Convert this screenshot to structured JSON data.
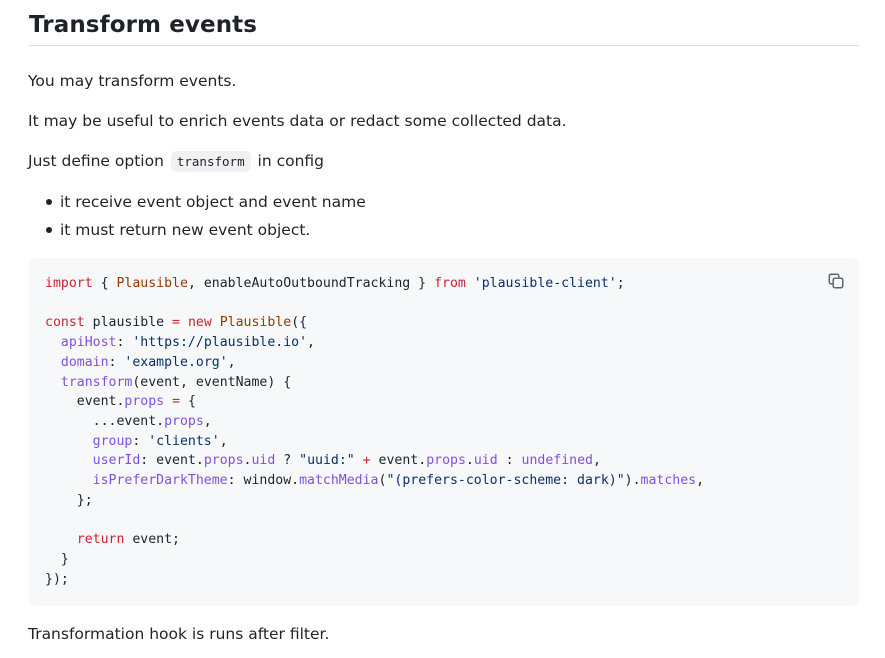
{
  "heading": "Transform events",
  "paragraphs": {
    "p1": "You may transform events.",
    "p2": "It may be useful to enrich events data or redact some collected data.",
    "p3_before": "Just define option",
    "p3_code": "transform",
    "p3_after": "in config"
  },
  "bullets": [
    "it receive event object and event name",
    "it must return new event object."
  ],
  "code": {
    "line1": {
      "import": "import",
      "open": " { ",
      "cls": "Plausible",
      "rest": ", enableAutoOutboundTracking } ",
      "from": "from",
      "sp": " ",
      "str": "'plausible-client'",
      "end": ";"
    },
    "line3": {
      "const": "const",
      "name": " plausible ",
      "eq": "=",
      "sp": " ",
      "new": "new",
      "sp2": " ",
      "cls": "Plausible",
      "end": "({"
    },
    "line4": {
      "indent": "  ",
      "prop": "apiHost",
      "colon": ": ",
      "str": "'https://plausible.io'",
      "end": ","
    },
    "line5": {
      "indent": "  ",
      "prop": "domain",
      "colon": ": ",
      "str": "'example.org'",
      "end": ","
    },
    "line6": {
      "indent": "  ",
      "prop": "transform",
      "rest": "(event, eventName) {"
    },
    "line7": {
      "indent": "    event.",
      "prop": "props",
      "sp": " ",
      "eq": "=",
      "end": " {"
    },
    "line8": {
      "indent": "      ...event.",
      "prop": "props",
      "end": ","
    },
    "line9": {
      "indent": "      ",
      "prop": "group",
      "colon": ": ",
      "str": "'clients'",
      "end": ","
    },
    "line10": {
      "indent": "      ",
      "prop": "userId",
      "colon": ": event.",
      "prop2": "props",
      "dot": ".",
      "prop3": "uid",
      "q": " ? ",
      "str": "\"uuid:\"",
      "sp": " ",
      "plus": "+",
      "mid": " event.",
      "prop4": "props",
      "dot2": ".",
      "prop5": "uid",
      "c": " : ",
      "undef": "undefined",
      "end": ","
    },
    "line11": {
      "indent": "      ",
      "prop": "isPreferDarkTheme",
      "colon": ": window.",
      "fn": "matchMedia",
      "open": "(",
      "str": "\"(prefers-color-scheme: dark)\"",
      "close": ").",
      "prop2": "matches",
      "end": ","
    },
    "line12": "    };",
    "line14": {
      "indent": "    ",
      "ret": "return",
      "rest": " event;"
    },
    "line15": "  }",
    "line16": "});"
  },
  "footer": "Transformation hook is runs after filter.",
  "icons": {
    "copy": "copy-icon"
  }
}
